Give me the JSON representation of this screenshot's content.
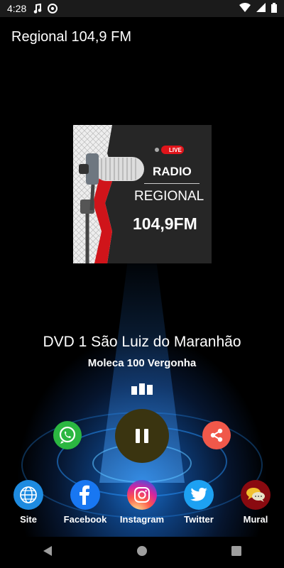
{
  "statusbar": {
    "time": "4:28"
  },
  "appbar": {
    "title": "Regional 104,9 FM"
  },
  "cover": {
    "live": "LIVE",
    "line1": "RADIO",
    "line2": "REGIONAL",
    "line3": "104,9FM"
  },
  "player": {
    "song": "DVD 1  São Luiz do Maranhão",
    "artist": "Moleca 100 Vergonha",
    "state": "playing"
  },
  "links": [
    {
      "label": "Site",
      "icon": "globe-icon",
      "color": "#1e8be0"
    },
    {
      "label": "Facebook",
      "icon": "facebook-icon",
      "color": "#1877f2"
    },
    {
      "label": "Instagram",
      "icon": "instagram-icon",
      "color": "#d6249f"
    },
    {
      "label": "Twitter",
      "icon": "twitter-icon",
      "color": "#1da1f2"
    },
    {
      "label": "Mural",
      "icon": "chat-bubbles-icon",
      "color": "#b3001b"
    }
  ],
  "colors": {
    "whatsapp": "#2bb741",
    "share": "#f0584a",
    "accent": "#1a6ec8"
  }
}
